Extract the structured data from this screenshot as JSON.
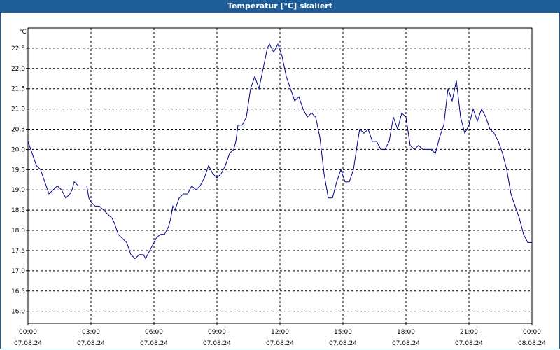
{
  "window": {
    "title": "Temperatur [°C] skaliert"
  },
  "chart_data": {
    "type": "line",
    "title": "Temperatur [°C] skaliert",
    "ylabel": "°C",
    "xlabel": "",
    "ylim": [
      15.7,
      23.0
    ],
    "xlim": [
      0,
      24
    ],
    "grid": true,
    "y_ticks": [
      "16,0",
      "16,5",
      "17,0",
      "17,5",
      "18,0",
      "18,5",
      "19,0",
      "19,5",
      "20,0",
      "20,5",
      "21,0",
      "21,5",
      "22,0",
      "22,5"
    ],
    "x_ticks": [
      {
        "time": "00:00",
        "date": "07.08.24"
      },
      {
        "time": "03:00",
        "date": "07.08.24"
      },
      {
        "time": "06:00",
        "date": "07.08.24"
      },
      {
        "time": "09:00",
        "date": "07.08.24"
      },
      {
        "time": "12:00",
        "date": "07.08.24"
      },
      {
        "time": "15:00",
        "date": "07.08.24"
      },
      {
        "time": "18:00",
        "date": "07.08.24"
      },
      {
        "time": "21:00",
        "date": "07.08.24"
      },
      {
        "time": "00:00",
        "date": "08.08.24"
      }
    ],
    "series": [
      {
        "color": "#00008b",
        "points": [
          [
            0.0,
            20.2
          ],
          [
            0.2,
            19.9
          ],
          [
            0.4,
            19.6
          ],
          [
            0.6,
            19.5
          ],
          [
            0.8,
            19.2
          ],
          [
            1.0,
            18.9
          ],
          [
            1.2,
            19.0
          ],
          [
            1.4,
            19.1
          ],
          [
            1.6,
            19.0
          ],
          [
            1.8,
            18.8
          ],
          [
            2.0,
            18.9
          ],
          [
            2.1,
            19.0
          ],
          [
            2.2,
            19.2
          ],
          [
            2.4,
            19.1
          ],
          [
            2.6,
            19.1
          ],
          [
            2.8,
            19.1
          ],
          [
            2.9,
            18.8
          ],
          [
            3.0,
            18.7
          ],
          [
            3.2,
            18.6
          ],
          [
            3.4,
            18.6
          ],
          [
            3.6,
            18.5
          ],
          [
            3.8,
            18.4
          ],
          [
            4.0,
            18.3
          ],
          [
            4.1,
            18.2
          ],
          [
            4.3,
            17.9
          ],
          [
            4.5,
            17.8
          ],
          [
            4.7,
            17.7
          ],
          [
            4.9,
            17.4
          ],
          [
            5.1,
            17.3
          ],
          [
            5.3,
            17.4
          ],
          [
            5.5,
            17.4
          ],
          [
            5.6,
            17.3
          ],
          [
            5.8,
            17.5
          ],
          [
            6.0,
            17.7
          ],
          [
            6.1,
            17.8
          ],
          [
            6.3,
            17.9
          ],
          [
            6.5,
            17.9
          ],
          [
            6.7,
            18.1
          ],
          [
            6.8,
            18.3
          ],
          [
            6.9,
            18.6
          ],
          [
            7.0,
            18.5
          ],
          [
            7.2,
            18.8
          ],
          [
            7.4,
            18.9
          ],
          [
            7.6,
            18.9
          ],
          [
            7.8,
            19.1
          ],
          [
            8.0,
            19.0
          ],
          [
            8.2,
            19.1
          ],
          [
            8.4,
            19.3
          ],
          [
            8.6,
            19.6
          ],
          [
            8.8,
            19.4
          ],
          [
            9.0,
            19.3
          ],
          [
            9.2,
            19.4
          ],
          [
            9.4,
            19.6
          ],
          [
            9.6,
            19.9
          ],
          [
            9.8,
            20.0
          ],
          [
            9.9,
            20.2
          ],
          [
            10.0,
            20.6
          ],
          [
            10.2,
            20.6
          ],
          [
            10.4,
            20.8
          ],
          [
            10.6,
            21.5
          ],
          [
            10.8,
            21.8
          ],
          [
            11.0,
            21.5
          ],
          [
            11.2,
            22.0
          ],
          [
            11.4,
            22.5
          ],
          [
            11.5,
            22.6
          ],
          [
            11.7,
            22.4
          ],
          [
            11.9,
            22.6
          ],
          [
            12.1,
            22.3
          ],
          [
            12.3,
            21.8
          ],
          [
            12.5,
            21.5
          ],
          [
            12.7,
            21.2
          ],
          [
            12.9,
            21.3
          ],
          [
            13.1,
            21.0
          ],
          [
            13.3,
            20.8
          ],
          [
            13.5,
            20.9
          ],
          [
            13.7,
            20.8
          ],
          [
            13.9,
            20.3
          ],
          [
            14.1,
            19.4
          ],
          [
            14.3,
            18.8
          ],
          [
            14.5,
            18.8
          ],
          [
            14.7,
            19.2
          ],
          [
            14.9,
            19.5
          ],
          [
            15.1,
            19.2
          ],
          [
            15.3,
            19.2
          ],
          [
            15.5,
            19.5
          ],
          [
            15.7,
            20.2
          ],
          [
            15.8,
            20.5
          ],
          [
            16.0,
            20.4
          ],
          [
            16.2,
            20.5
          ],
          [
            16.4,
            20.2
          ],
          [
            16.6,
            20.2
          ],
          [
            16.8,
            20.0
          ],
          [
            17.0,
            20.0
          ],
          [
            17.2,
            20.2
          ],
          [
            17.4,
            20.8
          ],
          [
            17.6,
            20.5
          ],
          [
            17.8,
            20.9
          ],
          [
            18.0,
            20.8
          ],
          [
            18.2,
            20.1
          ],
          [
            18.4,
            20.0
          ],
          [
            18.6,
            20.1
          ],
          [
            18.8,
            20.0
          ],
          [
            19.0,
            20.0
          ],
          [
            19.2,
            20.0
          ],
          [
            19.4,
            19.9
          ],
          [
            19.6,
            20.3
          ],
          [
            19.8,
            20.6
          ],
          [
            20.0,
            21.5
          ],
          [
            20.2,
            21.2
          ],
          [
            20.4,
            21.7
          ],
          [
            20.6,
            20.8
          ],
          [
            20.8,
            20.4
          ],
          [
            21.0,
            20.6
          ],
          [
            21.2,
            21.0
          ],
          [
            21.4,
            20.7
          ],
          [
            21.6,
            21.0
          ],
          [
            21.8,
            20.8
          ],
          [
            22.0,
            20.5
          ],
          [
            22.2,
            20.4
          ],
          [
            22.4,
            20.2
          ],
          [
            22.6,
            19.9
          ],
          [
            22.8,
            19.5
          ],
          [
            23.0,
            18.9
          ],
          [
            23.2,
            18.6
          ],
          [
            23.4,
            18.3
          ],
          [
            23.6,
            17.9
          ],
          [
            23.8,
            17.7
          ],
          [
            24.0,
            17.7
          ]
        ]
      }
    ]
  }
}
